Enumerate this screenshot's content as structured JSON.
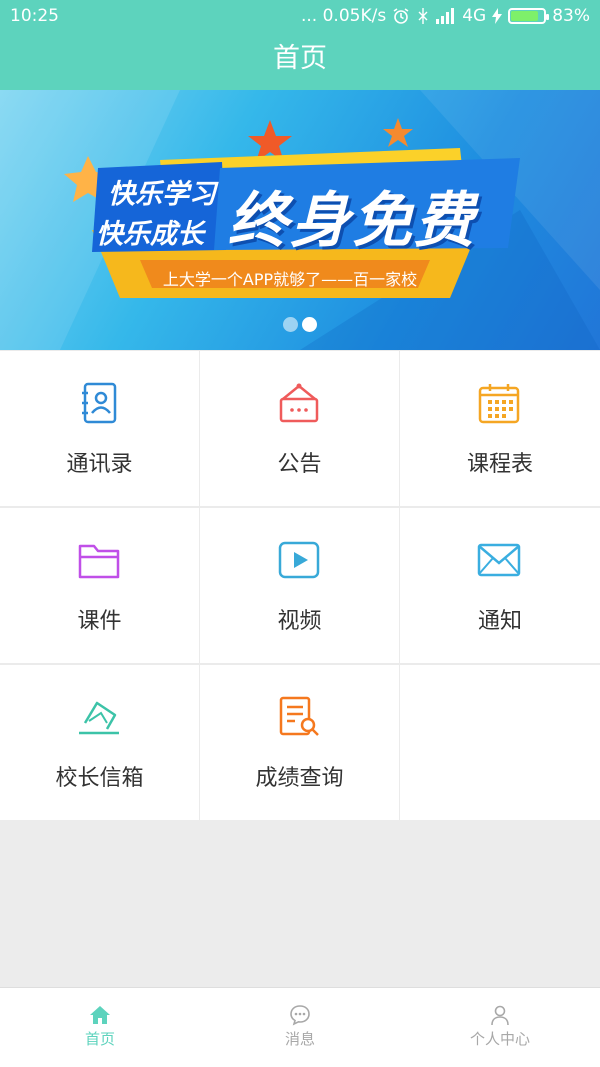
{
  "status_bar": {
    "time": "10:25",
    "network_speed": "... 0.05K/s",
    "network_type": "4G",
    "battery_percent": "83%",
    "battery_level": 0.83
  },
  "header": {
    "title": "首页"
  },
  "banner": {
    "tag_line1": "快乐学习",
    "tag_line2": "快乐成长",
    "headline": "终身免费",
    "ribbon_text": "上大学一个APP就够了——百一家校",
    "slide_count": 2,
    "active_slide": 2
  },
  "grid": {
    "items": [
      {
        "label": "通讯录",
        "icon": "contacts-icon",
        "color": "#2f8ad6"
      },
      {
        "label": "公告",
        "icon": "announcement-icon",
        "color": "#ef5b5b"
      },
      {
        "label": "课程表",
        "icon": "calendar-icon",
        "color": "#f5a623"
      },
      {
        "label": "课件",
        "icon": "folder-icon",
        "color": "#c04fe8"
      },
      {
        "label": "视频",
        "icon": "video-play-icon",
        "color": "#38a9d8"
      },
      {
        "label": "通知",
        "icon": "envelope-icon",
        "color": "#3aaee0"
      },
      {
        "label": "校长信箱",
        "icon": "mailbox-icon",
        "color": "#3cc3a8"
      },
      {
        "label": "成绩查询",
        "icon": "score-search-icon",
        "color": "#f5781e"
      }
    ]
  },
  "tabbar": {
    "items": [
      {
        "label": "首页",
        "icon": "home-icon",
        "active": true
      },
      {
        "label": "消息",
        "icon": "message-icon",
        "active": false
      },
      {
        "label": "个人中心",
        "icon": "person-icon",
        "active": false
      }
    ],
    "active_color": "#5dd3bd",
    "inactive_color": "#a8a8a8"
  }
}
